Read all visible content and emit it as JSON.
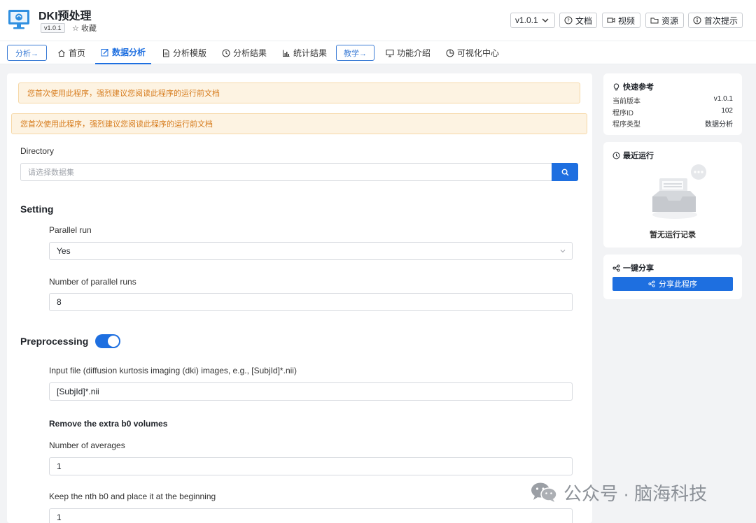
{
  "app": {
    "title": "DKI预处理",
    "version_badge": "v1.0.1",
    "favorite_label": "☆ 收藏"
  },
  "header": {
    "version_select": "v1.0.1",
    "docs_label": "文档",
    "video_label": "视频",
    "resources_label": "资源",
    "first_tips_label": "首次提示"
  },
  "nav": {
    "analysis_btn": "分析→",
    "teaching_btn": "教学→",
    "items": {
      "home": "首页",
      "data_analysis": "数据分析",
      "analysis_template": "分析模版",
      "analysis_results": "分析结果",
      "stat_results": "统计结果",
      "features": "功能介绍",
      "vis_center": "可视化中心"
    },
    "active": "data_analysis"
  },
  "main": {
    "alert1": "您首次使用此程序，强烈建议您阅读此程序的运行前文档",
    "alert2": "您首次使用此程序，强烈建议您阅读此程序的运行前文档",
    "directory": {
      "label": "Directory",
      "placeholder": "请选择数据集"
    },
    "setting": {
      "heading": "Setting",
      "parallel_run": {
        "label": "Parallel run",
        "value": "Yes"
      },
      "num_parallel": {
        "label": "Number of parallel runs",
        "value": "8"
      }
    },
    "preprocessing": {
      "heading": "Preprocessing",
      "enabled": true,
      "input_file": {
        "label": "Input file (diffusion kurtosis imaging (dki) images, e.g., [SubjId]*.nii)",
        "value": "[SubjId]*.nii"
      },
      "remove_b0": {
        "heading": "Remove the extra b0 volumes",
        "num_averages": {
          "label": "Number of averages",
          "value": "1"
        },
        "keep_nth": {
          "label": "Keep the nth b0 and place it at the beginning",
          "value": "1"
        }
      }
    }
  },
  "sidebar": {
    "quick_ref": {
      "title": "快速参考",
      "rows": [
        {
          "key": "当前版本",
          "value": "v1.0.1"
        },
        {
          "key": "程序ID",
          "value": "102"
        },
        {
          "key": "程序类型",
          "value": "数据分析"
        }
      ]
    },
    "recent_runs": {
      "title": "最近运行",
      "empty_text": "暂无运行记录"
    },
    "share": {
      "title": "一键分享",
      "button_label": "分享此程序"
    }
  },
  "watermark": {
    "text": "公众号 · 脑海科技"
  },
  "colors": {
    "primary": "#1e6fe0",
    "alert_bg": "#fdf3e2",
    "alert_text": "#d67b1c",
    "page_bg": "#f2f3f5"
  }
}
